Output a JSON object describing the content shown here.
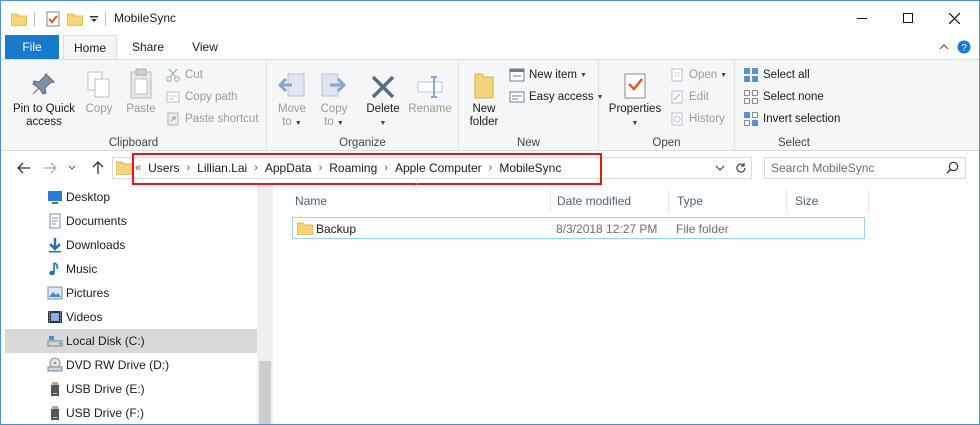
{
  "window": {
    "title": "MobileSync"
  },
  "ribbon_tabs": {
    "file": "File",
    "home": "Home",
    "share": "Share",
    "view": "View"
  },
  "clipboard": {
    "label": "Clipboard",
    "pin": "Pin to Quick access",
    "pin_line1": "Pin to Quick",
    "pin_line2": "access",
    "copy": "Copy",
    "paste": "Paste",
    "cut": "Cut",
    "copy_path": "Copy path",
    "paste_shortcut": "Paste shortcut"
  },
  "organize": {
    "label": "Organize",
    "move_to": "Move",
    "move_to_2": "to",
    "copy_to": "Copy",
    "copy_to_2": "to",
    "delete": "Delete",
    "rename": "Rename"
  },
  "new": {
    "label": "New",
    "new_folder_1": "New",
    "new_folder_2": "folder",
    "new_item": "New item",
    "easy_access": "Easy access"
  },
  "open": {
    "label": "Open",
    "properties": "Properties",
    "open": "Open",
    "edit": "Edit",
    "history": "History"
  },
  "select": {
    "label": "Select",
    "select_all": "Select all",
    "select_none": "Select none",
    "invert": "Invert selection"
  },
  "address": {
    "overflow": "«",
    "crumbs": [
      "Users",
      "Lillian.Lai",
      "AppData",
      "Roaming",
      "Apple Computer",
      "MobileSync"
    ]
  },
  "search": {
    "placeholder": "Search MobileSync"
  },
  "nav_pane": {
    "items": [
      {
        "label": "Desktop",
        "icon": "desktop-icon"
      },
      {
        "label": "Documents",
        "icon": "documents-icon"
      },
      {
        "label": "Downloads",
        "icon": "downloads-icon"
      },
      {
        "label": "Music",
        "icon": "music-icon"
      },
      {
        "label": "Pictures",
        "icon": "pictures-icon"
      },
      {
        "label": "Videos",
        "icon": "videos-icon"
      },
      {
        "label": "Local Disk (C:)",
        "icon": "local-disk-icon",
        "selected": true
      },
      {
        "label": "DVD RW Drive (D:)",
        "icon": "dvd-drive-icon"
      },
      {
        "label": "USB Drive (E:)",
        "icon": "usb-drive-icon"
      },
      {
        "label": "USB Drive (F:)",
        "icon": "usb-drive-icon"
      }
    ]
  },
  "columns": {
    "name": "Name",
    "date_modified": "Date modified",
    "type": "Type",
    "size": "Size"
  },
  "files": [
    {
      "name": "Backup",
      "date_modified": "8/3/2018 12:27 PM",
      "type": "File folder",
      "size": ""
    }
  ],
  "colors": {
    "accent": "#1979ca",
    "highlight_box": "#e5161d",
    "selected_row_border": "#99d1ff"
  }
}
